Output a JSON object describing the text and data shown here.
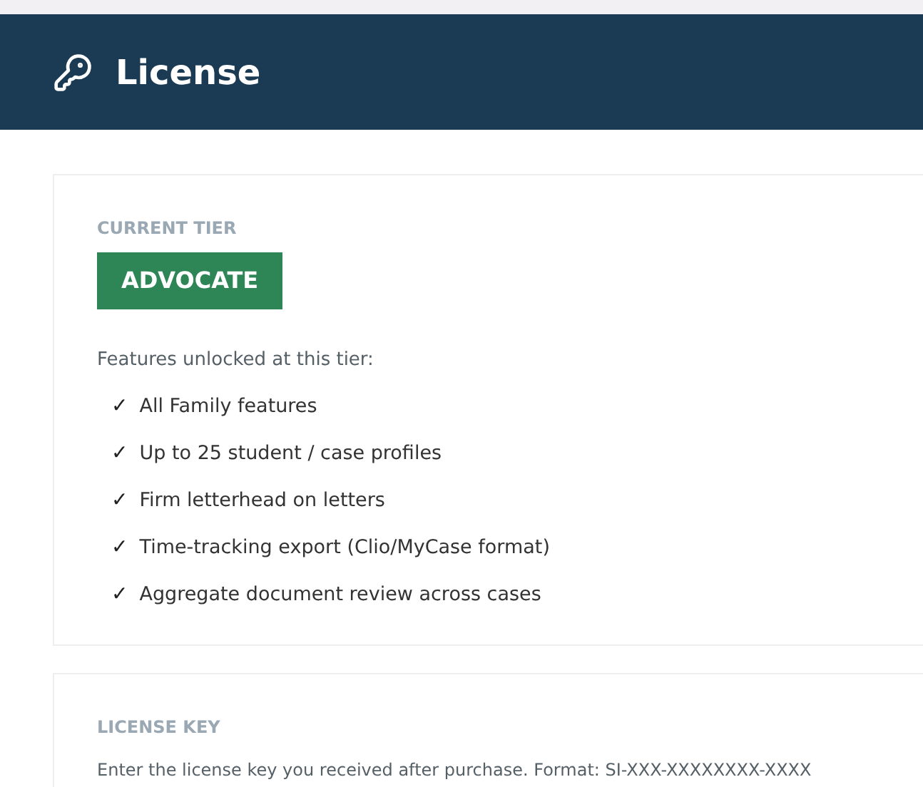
{
  "header": {
    "title": "License"
  },
  "tier_card": {
    "label": "CURRENT TIER",
    "tier": "ADVOCATE",
    "intro": "Features unlocked at this tier:",
    "features": [
      {
        "check": "✓",
        "text": "All Family features"
      },
      {
        "check": "✓",
        "text": "Up to 25 student / case profiles"
      },
      {
        "check": "✓",
        "text": "Firm letterhead on letters"
      },
      {
        "check": "✓",
        "text": "Time-tracking export (Clio/MyCase format)"
      },
      {
        "check": "✓",
        "text": "Aggregate document review across cases"
      }
    ]
  },
  "key_card": {
    "label": "LICENSE KEY",
    "description": "Enter the license key you received after purchase. Format: SI-XXX-XXXXXXXX-XXXX"
  }
}
